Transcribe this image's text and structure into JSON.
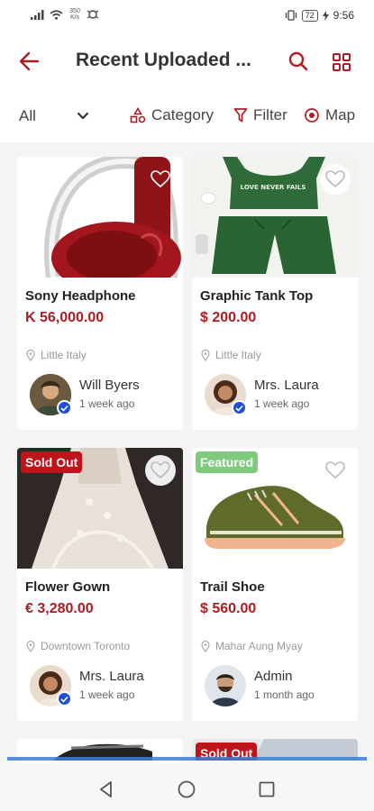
{
  "status_bar": {
    "speed_value": "350",
    "speed_unit": "K/s",
    "battery": "72",
    "time": "9:56"
  },
  "app_bar": {
    "title": "Recent Uploaded ...",
    "back_icon": "arrow-left-icon",
    "search_icon": "search-icon",
    "grid_icon": "grid-view-icon"
  },
  "filters": {
    "all_label": "All",
    "category_label": "Category",
    "filter_label": "Filter",
    "map_label": "Map"
  },
  "colors": {
    "brand": "#b01b21",
    "sold_badge": "#c0141b",
    "featured_badge": "#7ecb7e",
    "verified": "#1e4fd8"
  },
  "items": [
    {
      "title": "Sony Headphone",
      "price": "K 56,000.00",
      "location": "Little Italy",
      "seller": "Will Byers",
      "time": "1 week ago",
      "badge": ""
    },
    {
      "title": "Graphic Tank Top",
      "price": "$ 200.00",
      "location": "Little Italy",
      "seller": "Mrs. Laura",
      "time": "1 week ago",
      "badge": "",
      "print_text": "LOVE NEVER FAILS"
    },
    {
      "title": "Flower Gown",
      "price": "€ 3,280.00",
      "location": "Downtown Toronto",
      "seller": "Mrs. Laura",
      "time": "1 week ago",
      "badge": "Sold Out"
    },
    {
      "title": "Trail Shoe",
      "price": "$ 560.00",
      "location": "Mahar Aung Myay",
      "seller": "Admin",
      "time": "1 month ago",
      "badge": "Featured"
    },
    {
      "badge": "Sold Out"
    }
  ],
  "bottom_nav": {
    "back_icon": "triangle-back-icon",
    "home_icon": "circle-home-icon",
    "recents_icon": "square-recents-icon"
  }
}
